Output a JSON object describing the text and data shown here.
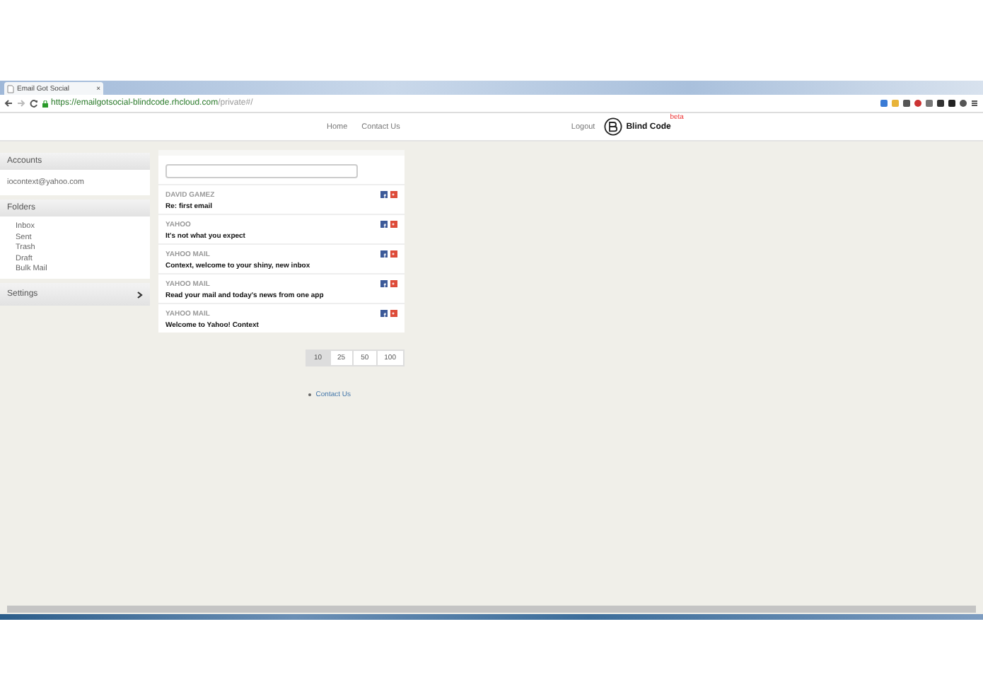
{
  "browser": {
    "tab_title": "Email Got Social",
    "tab_close": "×",
    "url_host": "https://emailgotsocial-blindcode.rhcloud.com",
    "url_path": "/private#/"
  },
  "nav": {
    "links": [
      "Home",
      "Contact Us"
    ],
    "logout": "Logout",
    "logo": "Blind Code",
    "badge": "beta"
  },
  "sidebar": [
    {
      "kind": "list",
      "title": "Accounts",
      "items": [
        "iocontext@yahoo.com"
      ]
    },
    {
      "kind": "list",
      "title": "Folders",
      "items": [
        "Inbox",
        "Sent",
        "Trash",
        "Draft",
        "Bulk Mail"
      ]
    },
    {
      "kind": "collapsed",
      "title": "Settings"
    }
  ],
  "messages": [
    {
      "sender": "DAVID GAMEZ",
      "subject": "Re: first email"
    },
    {
      "sender": "YAHOO",
      "subject": "It's not what you expect"
    },
    {
      "sender": "YAHOO MAIL",
      "subject": "Context, welcome to your shiny, new inbox"
    },
    {
      "sender": "YAHOO MAIL",
      "subject": "Read your mail and today's news from one app"
    },
    {
      "sender": "YAHOO MAIL",
      "subject": "Welcome to Yahoo! Context"
    }
  ],
  "pager": [
    {
      "label": "10",
      "selected": true
    },
    {
      "label": "25",
      "selected": false
    },
    {
      "label": "50",
      "selected": false
    },
    {
      "label": "100",
      "selected": false
    }
  ],
  "footer_links": [
    "Contact Us"
  ]
}
